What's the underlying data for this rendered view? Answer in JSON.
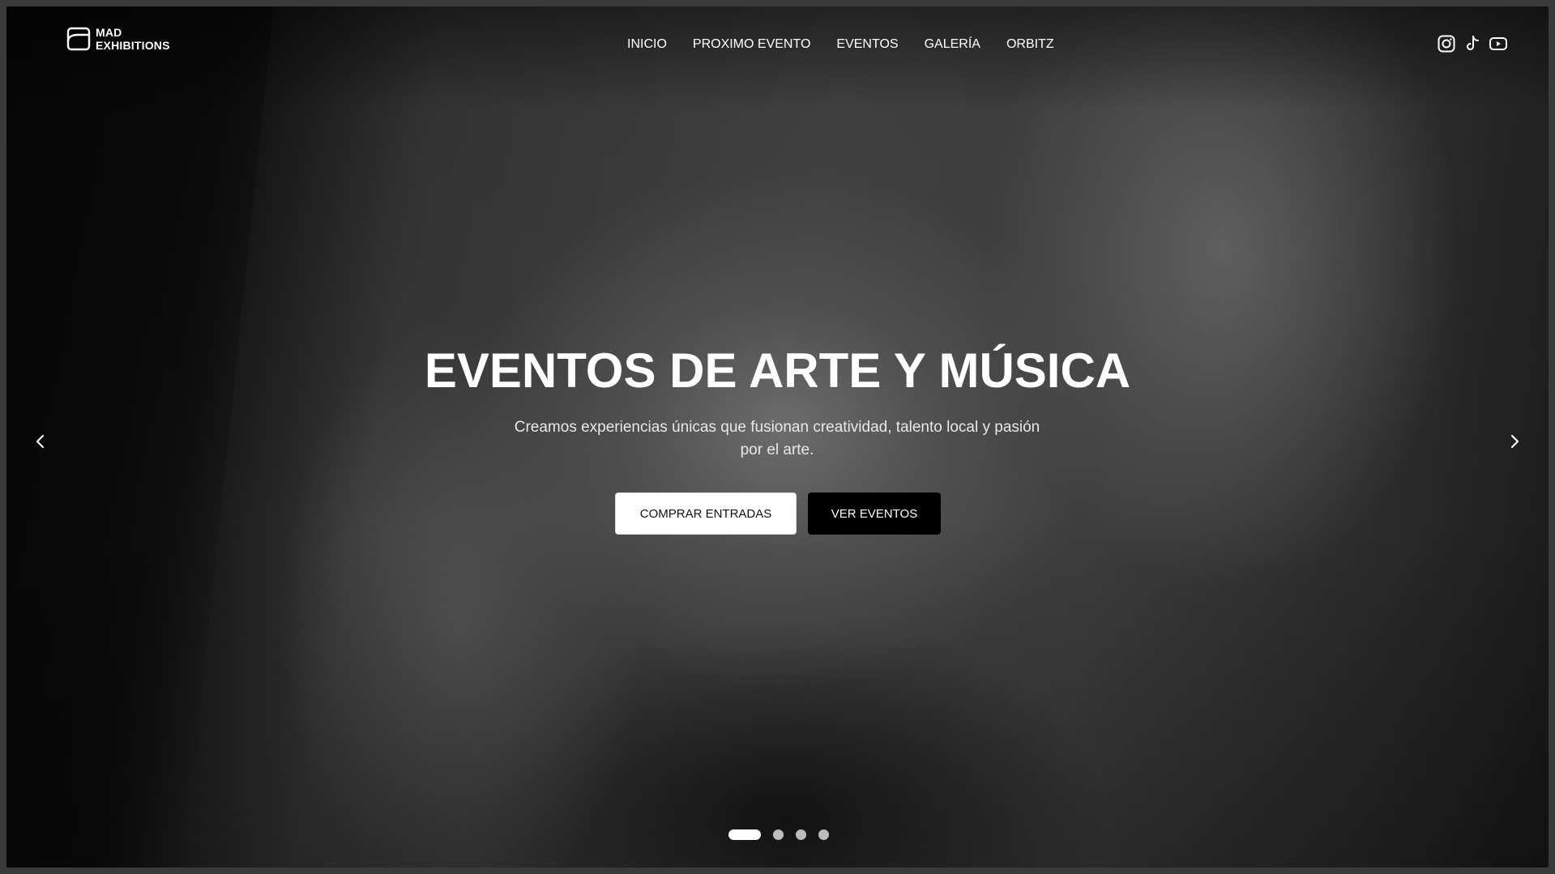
{
  "brand": {
    "name_line1": "MAD",
    "name_line2": "EXHIBITIONS"
  },
  "nav": {
    "items": [
      {
        "label": "INICIO"
      },
      {
        "label": "PROXIMO EVENTO"
      },
      {
        "label": "EVENTOS"
      },
      {
        "label": "GALERÍA"
      },
      {
        "label": "ORBITZ"
      }
    ]
  },
  "social": {
    "icons": [
      "instagram-icon",
      "tiktok-icon",
      "youtube-icon"
    ]
  },
  "hero": {
    "title": "EVENTOS DE ARTE Y MÚSICA",
    "subtitle": "Creamos experiencias únicas que fusionan creatividad, talento local y pasión por el arte.",
    "primary_button": "COMPRAR ENTRADAS",
    "secondary_button": "VER EVENTOS"
  },
  "carousel": {
    "slide_count": 4,
    "active_index": 0
  },
  "colors": {
    "text": "#ffffff",
    "button_light": "#ffffff",
    "button_dark": "#000000"
  }
}
